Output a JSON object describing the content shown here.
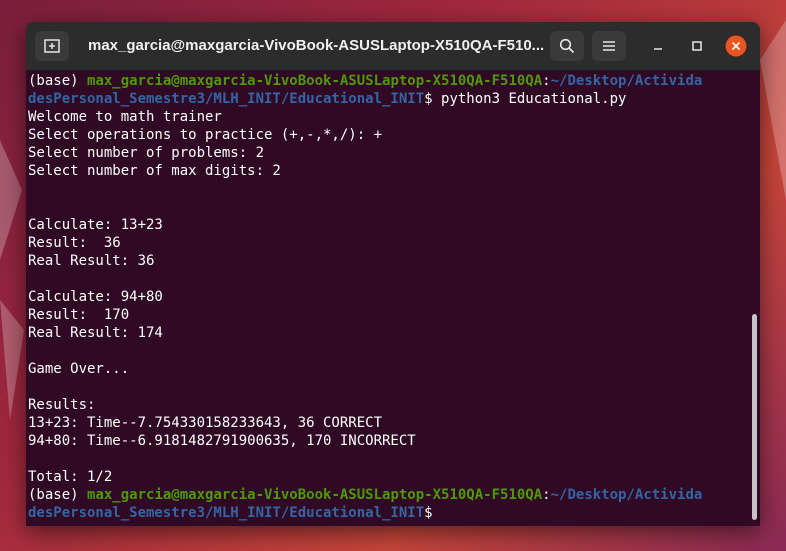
{
  "window": {
    "title": "max_garcia@maxgarcia-VivoBook-ASUSLaptop-X510QA-F510...",
    "icons": {
      "new_tab": "new-tab-icon",
      "search": "search-icon",
      "menu": "hamburger-menu-icon",
      "minimize": "minimize-icon",
      "maximize": "maximize-icon",
      "close": "close-icon"
    },
    "close_color": "#e95420"
  },
  "terminal": {
    "prompt1": {
      "env": "(base) ",
      "user_host": "max_garcia@maxgarcia-VivoBook-ASUSLaptop-X510QA-F510QA",
      "colon": ":",
      "path_part1": "~/Desktop/Activida",
      "path_part2": "desPersonal_Semestre3/MLH_INIT/Educational_INIT",
      "dollar": "$",
      "command": " python3 Educational.py"
    },
    "output": [
      "Welcome to math trainer",
      "Select operations to practice (+,-,*,/): +",
      "Select number of problems: 2",
      "Select number of max digits: 2",
      "",
      "",
      "Calculate: 13+23",
      "Result:  36",
      "Real Result: 36",
      "",
      "Calculate: 94+80",
      "Result:  170",
      "Real Result: 174",
      "",
      "Game Over...",
      "",
      "Results:",
      "13+23: Time--7.754330158233643, 36 CORRECT",
      "94+80: Time--6.9181482791900635, 170 INCORRECT",
      "",
      "Total: 1/2"
    ],
    "prompt2": {
      "env": "(base) ",
      "user_host": "max_garcia@maxgarcia-VivoBook-ASUSLaptop-X510QA-F510QA",
      "colon": ":",
      "path_part1": "~/Desktop/Activida",
      "path_part2": "desPersonal_Semestre3/MLH_INIT/Educational_INIT",
      "dollar": "$"
    }
  }
}
